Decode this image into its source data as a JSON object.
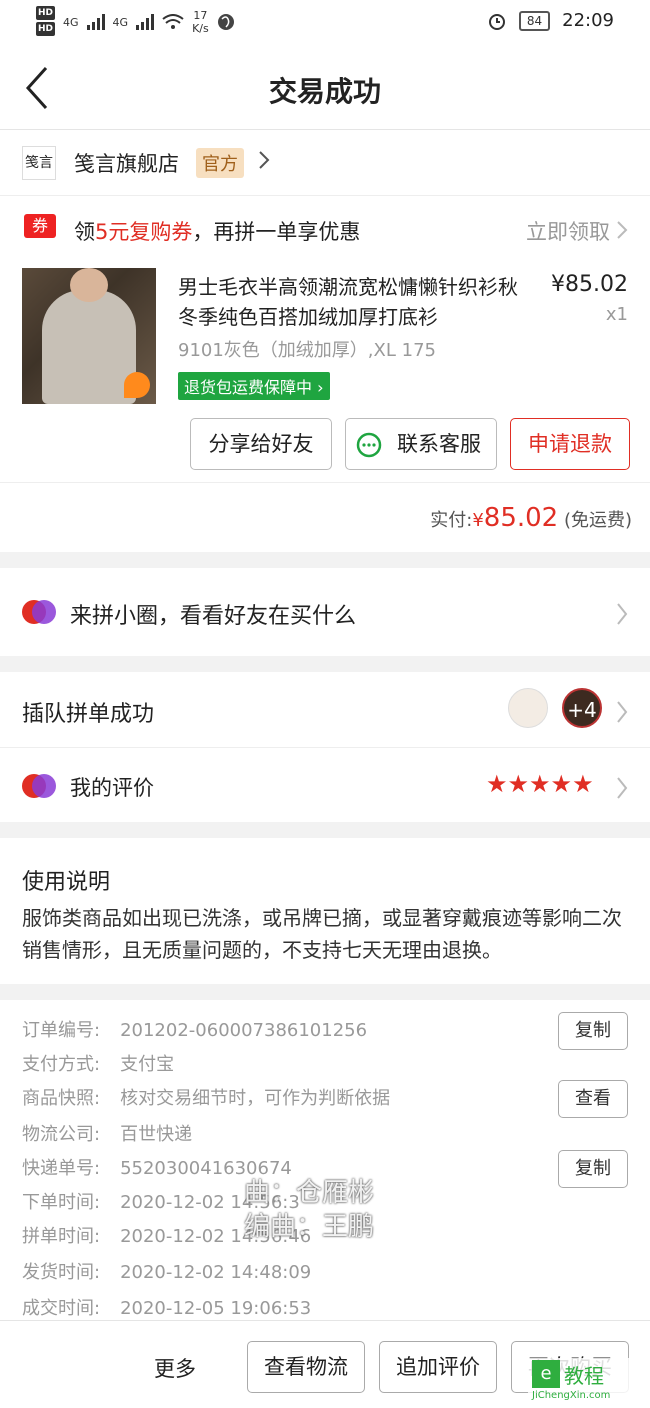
{
  "status_bar": {
    "hd1": "HD",
    "hd2": "HD",
    "net1": "4G",
    "net2": "4G",
    "speed": "17",
    "speed_unit": "K/s",
    "battery": "84",
    "time": "22:09"
  },
  "header": {
    "title": "交易成功"
  },
  "store": {
    "logo_text": "笺言",
    "name": "笺言旗舰店",
    "official": "官方"
  },
  "coupon": {
    "tag": "券",
    "text_pre": "领",
    "text_hl": "5元复购券",
    "text_post": "，再拼一单享优惠",
    "claim": "立即领取"
  },
  "product": {
    "title": "男士毛衣半高领潮流宽松慵懒针织衫秋冬季纯色百搭加绒加厚打底衫",
    "price": "¥85.02",
    "qty": "x1",
    "spec": "9101灰色（加绒加厚）,XL 175",
    "guarantee": "退货包运费保障中",
    "buttons": {
      "share": "分享给好友",
      "contact": "联系客服",
      "refund": "申请退款"
    }
  },
  "payment": {
    "label": "实付:",
    "currency": "¥",
    "amount": "85.02",
    "note": "(免运费)"
  },
  "circle": {
    "text": "来拼小圈，看看好友在买什么"
  },
  "group": {
    "text": "插队拼单成功",
    "more_count": "+4"
  },
  "review": {
    "text": "我的评价",
    "rating": 5
  },
  "usage": {
    "title": "使用说明",
    "body": "服饰类商品如出现已洗涤，或吊牌已摘，或显著穿戴痕迹等影响二次销售情形，且无质量问题的，不支持七天无理由退换。"
  },
  "order_info": {
    "rows": [
      {
        "label": "订单编号:",
        "value": "201202-060007386101256"
      },
      {
        "label": "支付方式:",
        "value": "支付宝"
      },
      {
        "label": "商品快照:",
        "value": "核对交易细节时，可作为判断依据"
      },
      {
        "label": "物流公司:",
        "value": "百世快递"
      },
      {
        "label": "快递单号:",
        "value": "552030041630674"
      },
      {
        "label": "下单时间:",
        "value": "2020-12-02 14:56:3"
      },
      {
        "label": "拼单时间:",
        "value": "2020-12-02 14:56:46"
      },
      {
        "label": "发货时间:",
        "value": "2020-12-02 14:48:09"
      },
      {
        "label": "成交时间:",
        "value": "2020-12-05 19:06:53"
      }
    ],
    "copy_label": "复制",
    "view_label": "查看"
  },
  "watermark": {
    "line1": "曲：仓雁彬",
    "line2": "编曲：王鹏"
  },
  "bottom_bar": {
    "more": "更多",
    "logistics": "查看物流",
    "add_review": "追加评价",
    "rebuy": "再次购买"
  },
  "site_mark": {
    "cn": "教程",
    "url": "JiChengXin.com"
  }
}
